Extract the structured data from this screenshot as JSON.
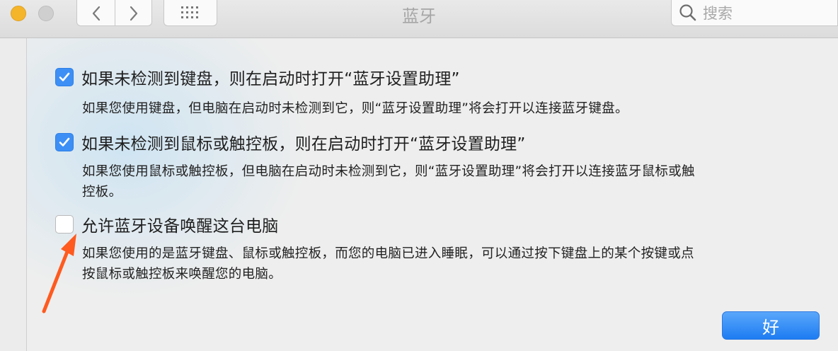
{
  "window": {
    "title": "蓝牙"
  },
  "search": {
    "placeholder": "搜索"
  },
  "options": [
    {
      "label": "如果未检测到键盘，则在启动时打开“蓝牙设置助理”",
      "checked": true,
      "description": "如果您使用键盘，但电脑在启动时未检测到它，则“蓝牙设置助理”将会打开以连接蓝牙键盘。"
    },
    {
      "label": "如果未检测到鼠标或触控板，则在启动时打开“蓝牙设置助理”",
      "checked": true,
      "description_line1": "如果您使用鼠标或触控板，但电脑在启动时未检测到它，则“蓝牙设置助理”将会打开以连接蓝牙鼠标或触",
      "description_line2": "控板。"
    },
    {
      "label": "允许蓝牙设备唤醒这台电脑",
      "checked": false,
      "description_line1": "如果您使用的是蓝牙键盘、鼠标或触控板，而您的电脑已进入睡眠，可以通过按下键盘上的某个按键或点",
      "description_line2": "按鼠标或触控板来唤醒您的电脑。"
    }
  ],
  "ok_button": {
    "label": "好"
  },
  "colors": {
    "accent": "#3d8ff5",
    "annotation_arrow": "#ff5a1f"
  },
  "annotation": {
    "icon": "annotation-arrow"
  }
}
